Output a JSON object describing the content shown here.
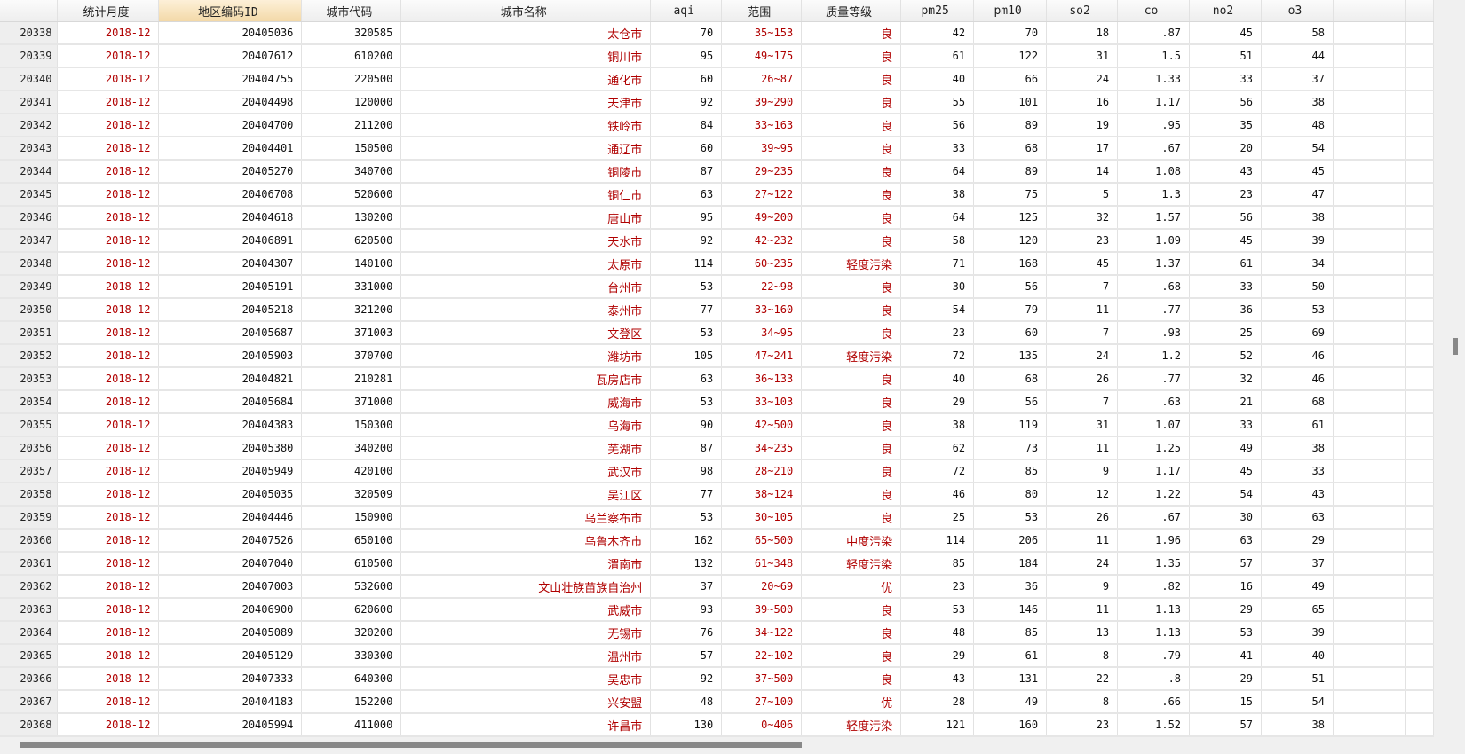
{
  "columns": [
    "",
    "统计月度",
    "地区编码ID",
    "城市代码",
    "城市名称",
    "aqi",
    "范围",
    "质量等级",
    "pm25",
    "pm10",
    "so2",
    "co",
    "no2",
    "o3",
    "",
    ""
  ],
  "selected_column": 2,
  "rows": [
    [
      "20338",
      "2018-12",
      "20405036",
      "320585",
      "太仓市",
      "70",
      "35~153",
      "良",
      "42",
      "70",
      "18",
      ".87",
      "45",
      "58"
    ],
    [
      "20339",
      "2018-12",
      "20407612",
      "610200",
      "铜川市",
      "95",
      "49~175",
      "良",
      "61",
      "122",
      "31",
      "1.5",
      "51",
      "44"
    ],
    [
      "20340",
      "2018-12",
      "20404755",
      "220500",
      "通化市",
      "60",
      "26~87",
      "良",
      "40",
      "66",
      "24",
      "1.33",
      "33",
      "37"
    ],
    [
      "20341",
      "2018-12",
      "20404498",
      "120000",
      "天津市",
      "92",
      "39~290",
      "良",
      "55",
      "101",
      "16",
      "1.17",
      "56",
      "38"
    ],
    [
      "20342",
      "2018-12",
      "20404700",
      "211200",
      "铁岭市",
      "84",
      "33~163",
      "良",
      "56",
      "89",
      "19",
      ".95",
      "35",
      "48"
    ],
    [
      "20343",
      "2018-12",
      "20404401",
      "150500",
      "通辽市",
      "60",
      "39~95",
      "良",
      "33",
      "68",
      "17",
      ".67",
      "20",
      "54"
    ],
    [
      "20344",
      "2018-12",
      "20405270",
      "340700",
      "铜陵市",
      "87",
      "29~235",
      "良",
      "64",
      "89",
      "14",
      "1.08",
      "43",
      "45"
    ],
    [
      "20345",
      "2018-12",
      "20406708",
      "520600",
      "铜仁市",
      "63",
      "27~122",
      "良",
      "38",
      "75",
      "5",
      "1.3",
      "23",
      "47"
    ],
    [
      "20346",
      "2018-12",
      "20404618",
      "130200",
      "唐山市",
      "95",
      "49~200",
      "良",
      "64",
      "125",
      "32",
      "1.57",
      "56",
      "38"
    ],
    [
      "20347",
      "2018-12",
      "20406891",
      "620500",
      "天水市",
      "92",
      "42~232",
      "良",
      "58",
      "120",
      "23",
      "1.09",
      "45",
      "39"
    ],
    [
      "20348",
      "2018-12",
      "20404307",
      "140100",
      "太原市",
      "114",
      "60~235",
      "轻度污染",
      "71",
      "168",
      "45",
      "1.37",
      "61",
      "34"
    ],
    [
      "20349",
      "2018-12",
      "20405191",
      "331000",
      "台州市",
      "53",
      "22~98",
      "良",
      "30",
      "56",
      "7",
      ".68",
      "33",
      "50"
    ],
    [
      "20350",
      "2018-12",
      "20405218",
      "321200",
      "泰州市",
      "77",
      "33~160",
      "良",
      "54",
      "79",
      "11",
      ".77",
      "36",
      "53"
    ],
    [
      "20351",
      "2018-12",
      "20405687",
      "371003",
      "文登区",
      "53",
      "34~95",
      "良",
      "23",
      "60",
      "7",
      ".93",
      "25",
      "69"
    ],
    [
      "20352",
      "2018-12",
      "20405903",
      "370700",
      "潍坊市",
      "105",
      "47~241",
      "轻度污染",
      "72",
      "135",
      "24",
      "1.2",
      "52",
      "46"
    ],
    [
      "20353",
      "2018-12",
      "20404821",
      "210281",
      "瓦房店市",
      "63",
      "36~133",
      "良",
      "40",
      "68",
      "26",
      ".77",
      "32",
      "46"
    ],
    [
      "20354",
      "2018-12",
      "20405684",
      "371000",
      "威海市",
      "53",
      "33~103",
      "良",
      "29",
      "56",
      "7",
      ".63",
      "21",
      "68"
    ],
    [
      "20355",
      "2018-12",
      "20404383",
      "150300",
      "乌海市",
      "90",
      "42~500",
      "良",
      "38",
      "119",
      "31",
      "1.07",
      "33",
      "61"
    ],
    [
      "20356",
      "2018-12",
      "20405380",
      "340200",
      "芜湖市",
      "87",
      "34~235",
      "良",
      "62",
      "73",
      "11",
      "1.25",
      "49",
      "38"
    ],
    [
      "20357",
      "2018-12",
      "20405949",
      "420100",
      "武汉市",
      "98",
      "28~210",
      "良",
      "72",
      "85",
      "9",
      "1.17",
      "45",
      "33"
    ],
    [
      "20358",
      "2018-12",
      "20405035",
      "320509",
      "吴江区",
      "77",
      "38~124",
      "良",
      "46",
      "80",
      "12",
      "1.22",
      "54",
      "43"
    ],
    [
      "20359",
      "2018-12",
      "20404446",
      "150900",
      "乌兰察布市",
      "53",
      "30~105",
      "良",
      "25",
      "53",
      "26",
      ".67",
      "30",
      "63"
    ],
    [
      "20360",
      "2018-12",
      "20407526",
      "650100",
      "乌鲁木齐市",
      "162",
      "65~500",
      "中度污染",
      "114",
      "206",
      "11",
      "1.96",
      "63",
      "29"
    ],
    [
      "20361",
      "2018-12",
      "20407040",
      "610500",
      "渭南市",
      "132",
      "61~348",
      "轻度污染",
      "85",
      "184",
      "24",
      "1.35",
      "57",
      "37"
    ],
    [
      "20362",
      "2018-12",
      "20407003",
      "532600",
      "文山壮族苗族自治州",
      "37",
      "20~69",
      "优",
      "23",
      "36",
      "9",
      ".82",
      "16",
      "49"
    ],
    [
      "20363",
      "2018-12",
      "20406900",
      "620600",
      "武威市",
      "93",
      "39~500",
      "良",
      "53",
      "146",
      "11",
      "1.13",
      "29",
      "65"
    ],
    [
      "20364",
      "2018-12",
      "20405089",
      "320200",
      "无锡市",
      "76",
      "34~122",
      "良",
      "48",
      "85",
      "13",
      "1.13",
      "53",
      "39"
    ],
    [
      "20365",
      "2018-12",
      "20405129",
      "330300",
      "温州市",
      "57",
      "22~102",
      "良",
      "29",
      "61",
      "8",
      ".79",
      "41",
      "40"
    ],
    [
      "20366",
      "2018-12",
      "20407333",
      "640300",
      "吴忠市",
      "92",
      "37~500",
      "良",
      "43",
      "131",
      "22",
      ".8",
      "29",
      "51"
    ],
    [
      "20367",
      "2018-12",
      "20404183",
      "152200",
      "兴安盟",
      "48",
      "27~100",
      "优",
      "28",
      "49",
      "8",
      ".66",
      "15",
      "54"
    ],
    [
      "20368",
      "2018-12",
      "20405994",
      "411000",
      "许昌市",
      "130",
      "0~406",
      "轻度污染",
      "121",
      "160",
      "23",
      "1.52",
      "57",
      "38"
    ]
  ],
  "colors": {
    "text_red": "#b00000",
    "header_selected": "#f3d9a8"
  }
}
